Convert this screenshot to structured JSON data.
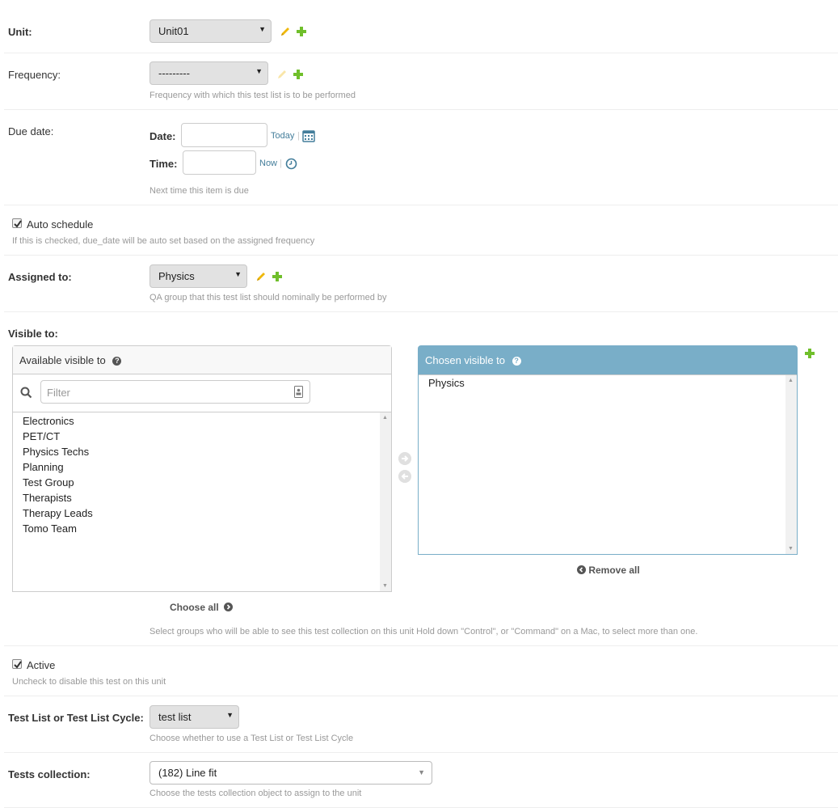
{
  "unit": {
    "label": "Unit:",
    "value": "Unit01"
  },
  "frequency": {
    "label": "Frequency:",
    "value": "---------",
    "help": "Frequency with which this test list is to be performed"
  },
  "due_date": {
    "label": "Due date:",
    "date_label": "Date:",
    "date_value": "",
    "today": "Today",
    "time_label": "Time:",
    "time_value": "",
    "now": "Now",
    "help": "Next time this item is due"
  },
  "auto_schedule": {
    "label": "Auto schedule",
    "checked": true,
    "help": "If this is checked, due_date will be auto set based on the assigned frequency"
  },
  "assigned_to": {
    "label": "Assigned to:",
    "value": "Physics",
    "help": "QA group that this test list should nominally be performed by"
  },
  "visible_to": {
    "label": "Visible to:",
    "available_title": "Available visible to",
    "filter_placeholder": "Filter",
    "available": [
      "Electronics",
      "PET/CT",
      "Physics Techs",
      "Planning",
      "Test Group",
      "Therapists",
      "Therapy Leads",
      "Tomo Team"
    ],
    "chosen_title": "Chosen visible to",
    "chosen": [
      "Physics"
    ],
    "choose_all": "Choose all",
    "remove_all": "Remove all",
    "help": "Select groups who will be able to see this test collection on this unit Hold down \"Control\", or \"Command\" on a Mac, to select more than one."
  },
  "active": {
    "label": "Active",
    "checked": true,
    "help": "Uncheck to disable this test on this unit"
  },
  "content_type": {
    "label": "Test List or Test List Cycle:",
    "value": "test list",
    "help": "Choose whether to use a Test List or Test List Cycle"
  },
  "tests_collection": {
    "label": "Tests collection:",
    "value": "(182) Line fit",
    "help": "Choose the tests collection object to assign to the unit"
  },
  "colors": {
    "accent": "#79aec8",
    "link": "#447e9b",
    "pencil": "#efb80b",
    "plus": "#70bf2b"
  },
  "icons": {
    "edit": "pencil-icon",
    "add": "plus-icon",
    "calendar": "calendar-icon",
    "clock": "clock-icon",
    "search": "search-icon",
    "help": "help-icon"
  }
}
